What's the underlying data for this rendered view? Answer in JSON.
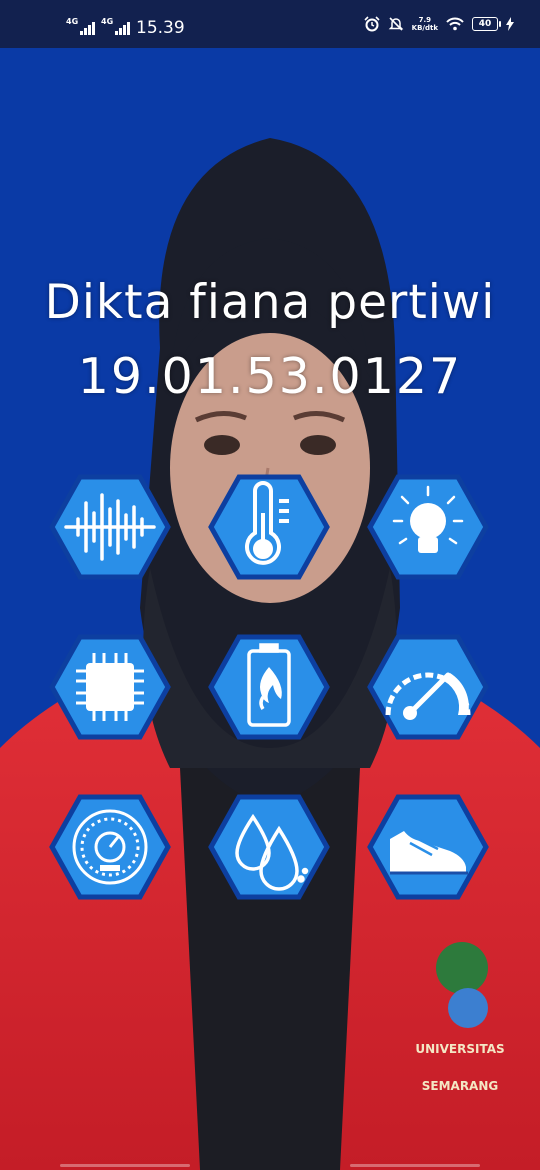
{
  "status_bar": {
    "net1": "4G",
    "net2": "4G",
    "time": "15.39",
    "speed_value": "7.9",
    "speed_unit": "KB/dtk",
    "battery": "40"
  },
  "profile": {
    "name": "Dikta fiana pertiwi",
    "nim": "19.01.53.0127"
  },
  "menu_icons": [
    {
      "name": "sound-wave-icon"
    },
    {
      "name": "thermometer-icon"
    },
    {
      "name": "light-bulb-icon"
    },
    {
      "name": "processor-chip-icon"
    },
    {
      "name": "battery-heat-icon"
    },
    {
      "name": "speedometer-icon"
    },
    {
      "name": "gauge-dial-icon"
    },
    {
      "name": "water-drop-icon"
    },
    {
      "name": "shoe-step-icon"
    }
  ],
  "colors": {
    "background_blue": "#0a3aa6",
    "status_bar": "#12214f",
    "hex_fill": "#2a8fe8",
    "hex_border": "#0d3fa0",
    "jacket_red": "#d8262e",
    "hijab": "#1b1e2a"
  }
}
